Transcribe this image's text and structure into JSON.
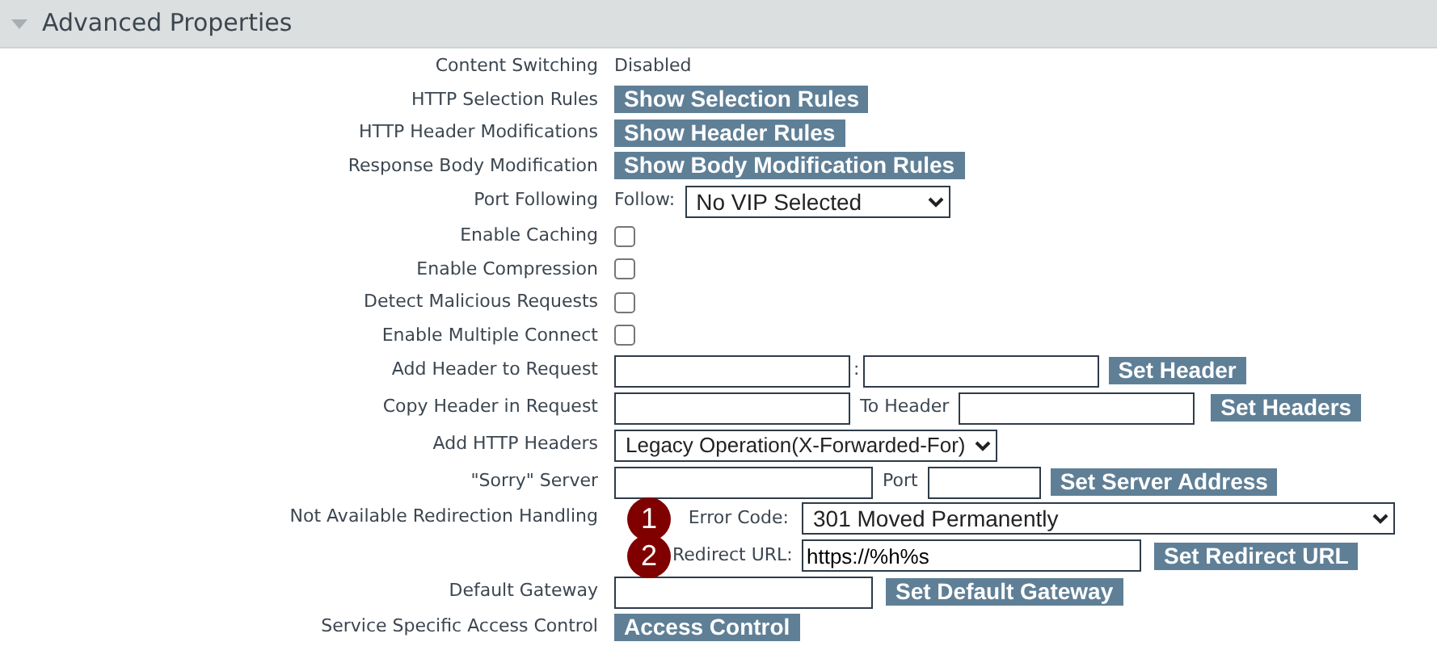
{
  "section": {
    "title": "Advanced Properties",
    "expanded": true
  },
  "rows": [
    {
      "label": "Content Switching",
      "kind": "text",
      "value": "Disabled"
    },
    {
      "label": "HTTP Selection Rules",
      "kind": "button",
      "button": "Show Selection Rules"
    },
    {
      "label": "HTTP Header Modifications",
      "kind": "button",
      "button": "Show Header Rules"
    },
    {
      "label": "Response Body Modification",
      "kind": "button",
      "button": "Show Body Modification Rules"
    },
    {
      "label": "Port Following",
      "kind": "follow",
      "prefix": "Follow:",
      "value": "No VIP Selected"
    },
    {
      "label": "Enable Caching",
      "kind": "checkbox",
      "checked": false
    },
    {
      "label": "Enable Compression",
      "kind": "checkbox",
      "checked": false
    },
    {
      "label": "Detect Malicious Requests",
      "kind": "checkbox",
      "checked": false
    },
    {
      "label": "Enable Multiple Connect",
      "kind": "checkbox",
      "checked": false
    },
    {
      "label": "Add Header to Request",
      "kind": "pair",
      "separator": ":",
      "button": "Set Header"
    },
    {
      "label": "Copy Header in Request",
      "kind": "pair",
      "separator": "To Header",
      "button": "Set Headers"
    },
    {
      "label": "Add HTTP Headers",
      "kind": "select",
      "value": "Legacy Operation(X-Forwarded-For)"
    },
    {
      "label": "\"Sorry\" Server",
      "kind": "server",
      "separator": "Port",
      "button": "Set Server Address"
    },
    {
      "label": "Not Available Redirection Handling",
      "kind": "redirect",
      "fields": [
        {
          "marker": "1",
          "label": "Error Code:",
          "kind": "select",
          "value": "301 Moved Permanently"
        },
        {
          "marker": "2",
          "label": "Redirect URL:",
          "kind": "input",
          "value": "https://%h%s",
          "button": "Set Redirect URL"
        }
      ]
    },
    {
      "label": "Default Gateway",
      "kind": "input-button",
      "button": "Set Default Gateway"
    },
    {
      "label": "Service Specific Access Control",
      "kind": "button",
      "button": "Access Control"
    }
  ]
}
